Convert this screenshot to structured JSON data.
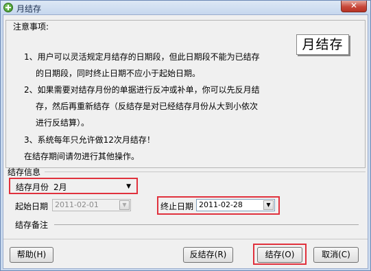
{
  "window": {
    "title": "月结存",
    "close_label": "✕"
  },
  "notes": {
    "legend": "注意事项:",
    "stamp": "月结存",
    "lines": [
      "1、用户可以灵活规定月结存的日期段，但此日期段不能为已结存",
      "的日期段，同时终止日期不应小于起始日期。",
      "2、如果需要对结存月份的单据进行反冲或补单，你可以先反月结",
      "存，然后再重新结存（反结存是对已经结存月份从大到小依次",
      "进行反结算）。",
      "3、系统每年只允许做12次月结存！",
      "在结存期间请勿进行其他操作。"
    ]
  },
  "info": {
    "legend": "结存信息",
    "month_label": "结存月份",
    "month_value": "2月",
    "start_label": "起始日期",
    "start_value": "2011-02-01",
    "end_label": "终止日期",
    "end_value": "2011-02-28",
    "remark_label": "结存备注",
    "remark_value": ""
  },
  "buttons": {
    "help": "帮助(H)",
    "reverse": "反结存(R)",
    "confirm": "结存(O)",
    "cancel": "取消(C)"
  },
  "colors": {
    "highlight": "#e0303c",
    "titlebar": "#c6d7ee"
  }
}
